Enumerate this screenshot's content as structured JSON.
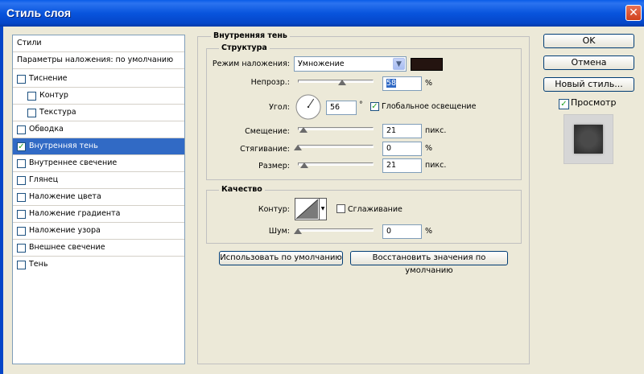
{
  "window": {
    "title": "Стиль слоя",
    "close_glyph": "✕"
  },
  "styles_list": {
    "header": "Стили",
    "blending": "Параметры наложения: по умолчанию",
    "items": [
      {
        "label": "Тиснение",
        "checked": false
      },
      {
        "label": "Контур",
        "checked": false
      },
      {
        "label": "Текстура",
        "checked": false
      },
      {
        "label": "Обводка",
        "checked": false
      },
      {
        "label": "Внутренняя тень",
        "checked": true
      },
      {
        "label": "Внутреннее свечение",
        "checked": false
      },
      {
        "label": "Глянец",
        "checked": false
      },
      {
        "label": "Наложение цвета",
        "checked": false
      },
      {
        "label": "Наложение градиента",
        "checked": false
      },
      {
        "label": "Наложение узора",
        "checked": false
      },
      {
        "label": "Внешнее свечение",
        "checked": false
      },
      {
        "label": "Тень",
        "checked": false
      }
    ]
  },
  "inner_shadow": {
    "title": "Внутренняя тень",
    "structure": {
      "title": "Структура",
      "blend_mode_label": "Режим наложения:",
      "blend_mode_value": "Умножение",
      "shadow_color": "#241410",
      "opacity_label": "Непрозр.:",
      "opacity_value": "58",
      "opacity_unit": "%",
      "opacity_level": 0.58,
      "angle_label": "Угол:",
      "angle_value": "56",
      "angle_unit": "°",
      "global_light_label": "Глобальное освещение",
      "global_light_checked": true,
      "distance_label": "Смещение:",
      "distance_value": "21",
      "distance_unit": "пикс.",
      "distance_level": 0.07,
      "choke_label": "Стягивание:",
      "choke_value": "0",
      "choke_unit": "%",
      "choke_level": 0.0,
      "size_label": "Размер:",
      "size_value": "21",
      "size_unit": "пикс.",
      "size_level": 0.08
    },
    "quality": {
      "title": "Качество",
      "contour_label": "Контур:",
      "antialias_label": "Сглаживание",
      "antialias_checked": false,
      "noise_label": "Шум:",
      "noise_value": "0",
      "noise_unit": "%",
      "noise_level": 0.0
    },
    "make_default_label": "Использовать по умолчанию",
    "reset_default_label": "Восстановить значения по умолчанию"
  },
  "buttons": {
    "ok": "OK",
    "cancel": "Отмена",
    "new_style": "Новый стиль...",
    "preview_label": "Просмотр",
    "preview_checked": true
  }
}
